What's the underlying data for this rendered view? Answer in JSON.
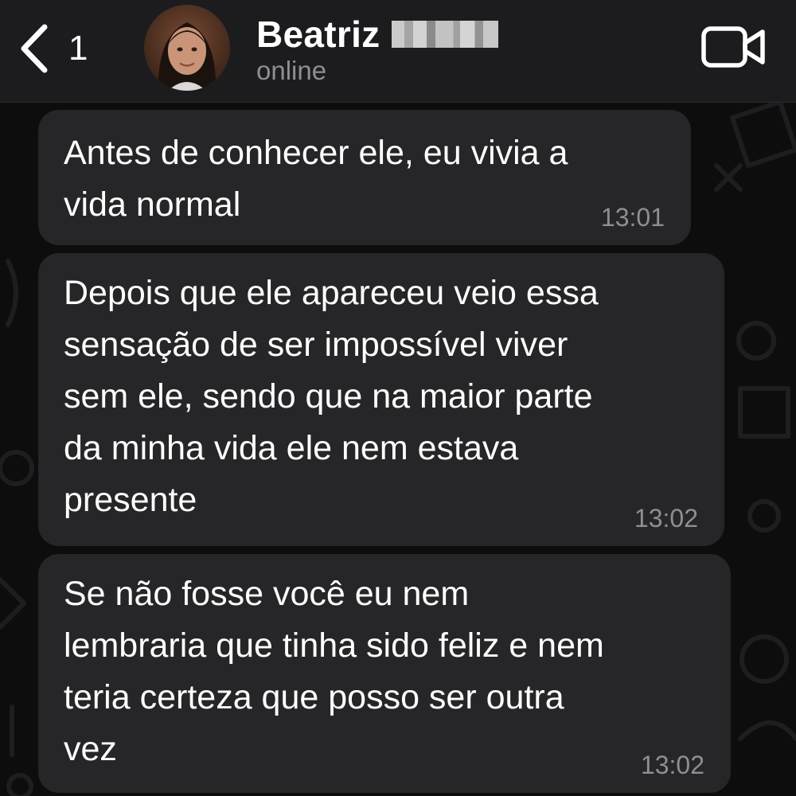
{
  "header": {
    "back_count": "1",
    "contact_name": "Beatriz",
    "status": "online"
  },
  "icons": {
    "back": "chevron-left-icon",
    "video": "video-camera-icon"
  },
  "messages": [
    {
      "text": "Antes de conhecer ele, eu vivia a\nvida normal",
      "time": "13:01"
    },
    {
      "text": "Depois que ele apareceu veio essa\nsensação de ser impossível viver\nsem ele, sendo que na maior parte\nda minha vida ele nem estava\npresente",
      "time": "13:02"
    },
    {
      "text": "Se não fosse você eu nem\nlembraria que tinha sido feliz e nem\nteria certeza que posso ser outra\nvez",
      "time": "13:02"
    }
  ],
  "colors": {
    "header_bg": "#1c1c1e",
    "bubble_bg": "#262628",
    "timestamp": "#8e8e93",
    "status": "#8e8e93"
  }
}
